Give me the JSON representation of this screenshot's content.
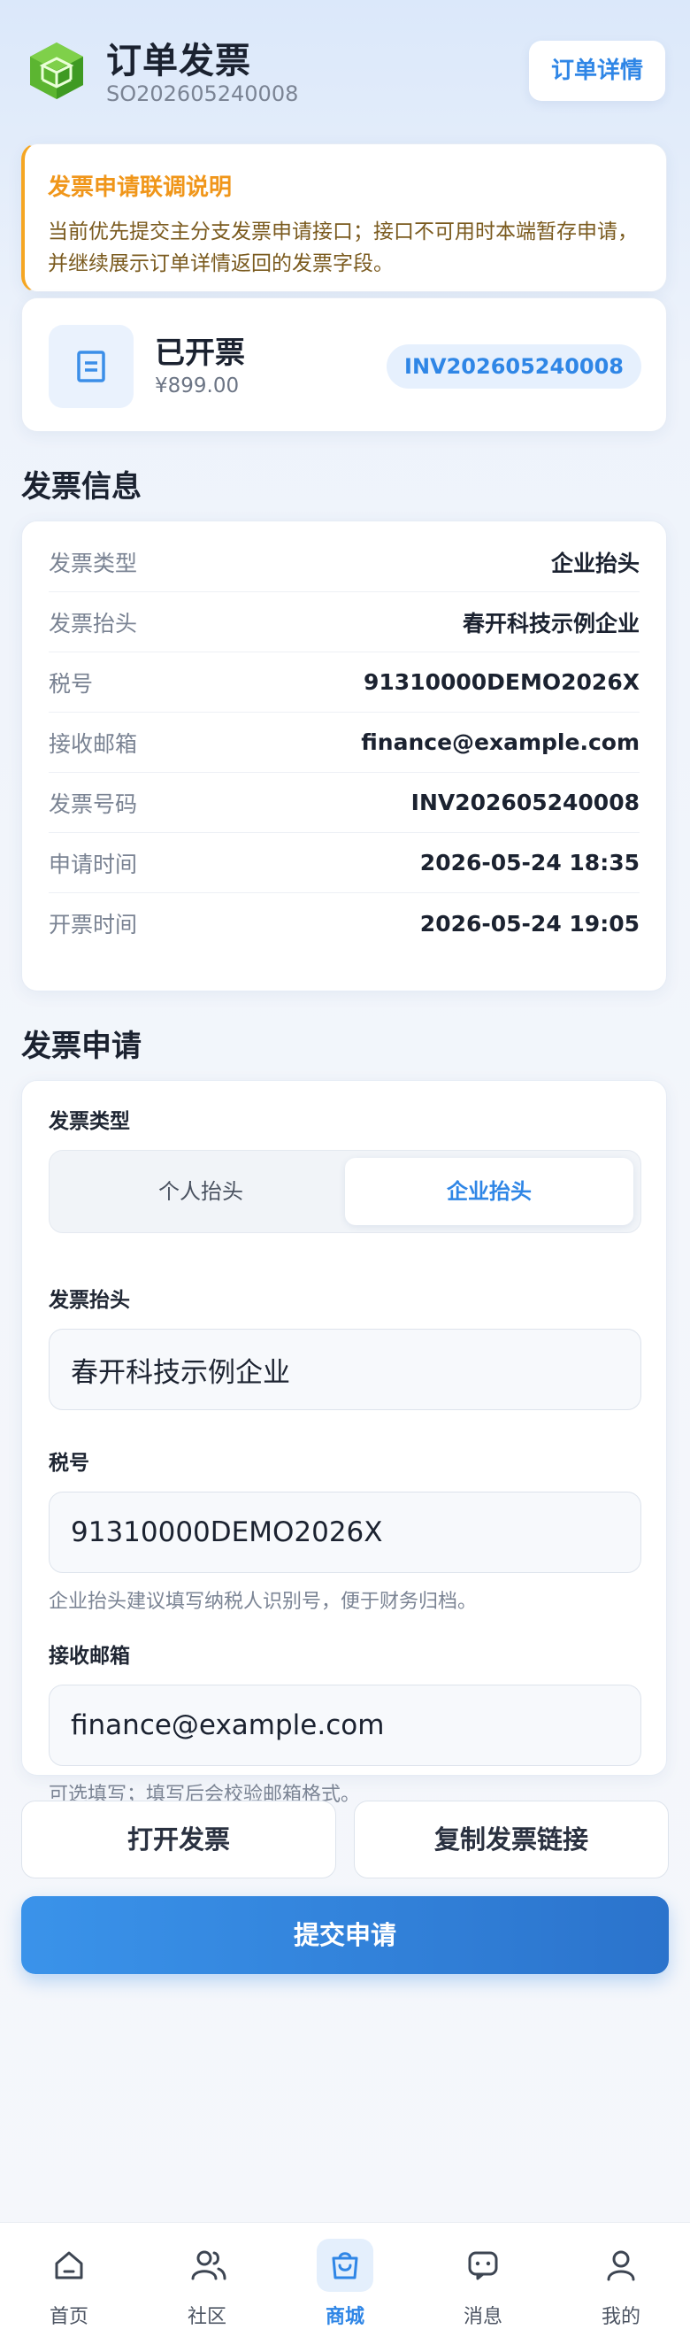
{
  "header": {
    "title": "订单发票",
    "order_no": "SO202605240008",
    "detail_button": "订单详情"
  },
  "notice": {
    "title": "发票申请联调说明",
    "text": "当前优先提交主分支发票申请接口；接口不可用时本端暂存申请，并继续展示订单详情返回的发票字段。"
  },
  "status": {
    "icon": "document-icon",
    "title": "已开票",
    "amount": "¥899.00",
    "invoice_no": "INV202605240008"
  },
  "info": {
    "section_title": "发票信息",
    "rows": [
      {
        "label": "发票类型",
        "value": "企业抬头"
      },
      {
        "label": "发票抬头",
        "value": "春开科技示例企业"
      },
      {
        "label": "税号",
        "value": "91310000DEMO2026X"
      },
      {
        "label": "接收邮箱",
        "value": "finance@example.com"
      },
      {
        "label": "发票号码",
        "value": "INV202605240008"
      },
      {
        "label": "申请时间",
        "value": "2026-05-24 18:35"
      },
      {
        "label": "开票时间",
        "value": "2026-05-24 19:05"
      }
    ]
  },
  "form": {
    "section_title": "发票申请",
    "type_label": "发票类型",
    "type_options": [
      "个人抬头",
      "企业抬头"
    ],
    "type_selected": "企业抬头",
    "title_label": "发票抬头",
    "title_value": "春开科技示例企业",
    "tax_label": "税号",
    "tax_value": "91310000DEMO2026X",
    "tax_hint": "企业抬头建议填写纳税人识别号，便于财务归档。",
    "email_label": "接收邮箱",
    "email_value": "finance@example.com",
    "email_hint": "可选填写；填写后会校验邮箱格式。"
  },
  "actions": {
    "open_invoice": "打开发票",
    "copy_link": "复制发票链接",
    "submit": "提交申请"
  },
  "tabbar": {
    "active": "商城",
    "items": [
      {
        "label": "首页",
        "icon": "home-icon"
      },
      {
        "label": "社区",
        "icon": "community-icon"
      },
      {
        "label": "商城",
        "icon": "shop-bag-icon"
      },
      {
        "label": "消息",
        "icon": "message-icon"
      },
      {
        "label": "我的",
        "icon": "profile-icon"
      }
    ]
  },
  "colors": {
    "accent": "#2f86e6",
    "notice": "#f0961a",
    "logo": "#5cb531"
  }
}
